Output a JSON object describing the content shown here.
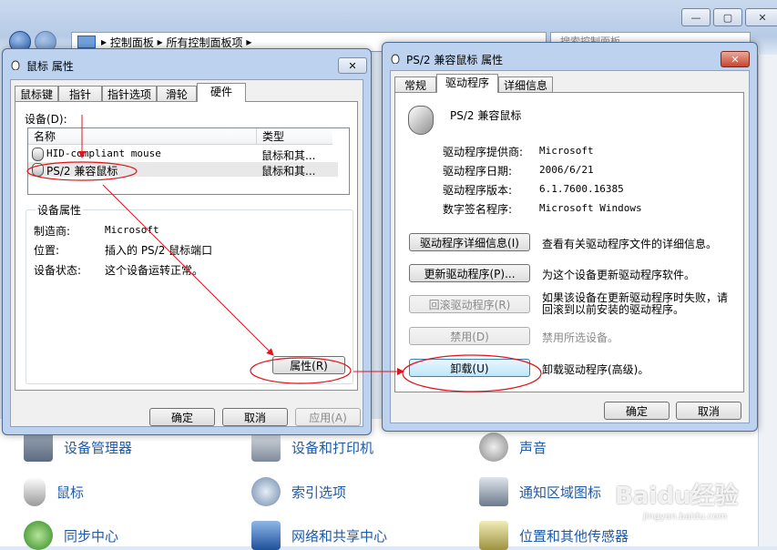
{
  "explorer": {
    "breadcrumb": [
      "控制面板",
      "所有控制面板项"
    ],
    "search_placeholder": "搜索控制面板",
    "items": [
      {
        "label": "设备管理器",
        "icon": "device-manager-icon"
      },
      {
        "label": "设备和打印机",
        "icon": "printer-icon"
      },
      {
        "label": "声音",
        "icon": "speaker-icon"
      },
      {
        "label": "鼠标",
        "icon": "mouse-icon"
      },
      {
        "label": "索引选项",
        "icon": "index-options-icon"
      },
      {
        "label": "通知区域图标",
        "icon": "notification-area-icon"
      },
      {
        "label": "同步中心",
        "icon": "sync-center-icon"
      },
      {
        "label": "网络和共享中心",
        "icon": "network-icon"
      },
      {
        "label": "位置和其他传感器",
        "icon": "sensor-icon"
      }
    ]
  },
  "mouse_dialog": {
    "title": "鼠标 属性",
    "tabs": [
      "鼠标键",
      "指针",
      "指针选项",
      "滑轮",
      "硬件"
    ],
    "devices_label": "设备(D):",
    "columns": [
      "名称",
      "类型"
    ],
    "devices": [
      {
        "name": "HID-compliant mouse",
        "type": "鼠标和其..."
      },
      {
        "name": "PS/2 兼容鼠标",
        "type": "鼠标和其..."
      }
    ],
    "props_title": "设备属性",
    "props": [
      {
        "key": "制造商:",
        "value": "Microsoft"
      },
      {
        "key": "位置:",
        "value": "插入的 PS/2 鼠标端口"
      },
      {
        "key": "设备状态:",
        "value": "这个设备运转正常。"
      }
    ],
    "properties_button": "属性(R)",
    "ok": "确定",
    "cancel": "取消",
    "apply": "应用(A)"
  },
  "ps2_dialog": {
    "title": "PS/2 兼容鼠标 属性",
    "tabs": [
      "常规",
      "驱动程序",
      "详细信息"
    ],
    "device_name": "PS/2 兼容鼠标",
    "info": [
      {
        "key": "驱动程序提供商:",
        "value": "Microsoft"
      },
      {
        "key": "驱动程序日期:",
        "value": "2006/6/21"
      },
      {
        "key": "驱动程序版本:",
        "value": "6.1.7600.16385"
      },
      {
        "key": "数字签名程序:",
        "value": "Microsoft Windows"
      }
    ],
    "actions": [
      {
        "button": "驱动程序详细信息(I)",
        "desc": "查看有关驱动程序文件的详细信息。"
      },
      {
        "button": "更新驱动程序(P)...",
        "desc": "为这个设备更新驱动程序软件。"
      },
      {
        "button": "回滚驱动程序(R)",
        "desc": "如果该设备在更新驱动程序时失败，请回滚到以前安装的驱动程序。"
      },
      {
        "button": "禁用(D)",
        "desc": "禁用所选设备。"
      },
      {
        "button": "卸载(U)",
        "desc": "卸载驱动程序(高级)。"
      }
    ],
    "ok": "确定",
    "cancel": "取消"
  },
  "colors": {
    "annotation": "#e0141c",
    "link": "#1e5aa8"
  },
  "watermark": {
    "brand": "Baidu经验",
    "url": "jingyan.baidu.com"
  }
}
